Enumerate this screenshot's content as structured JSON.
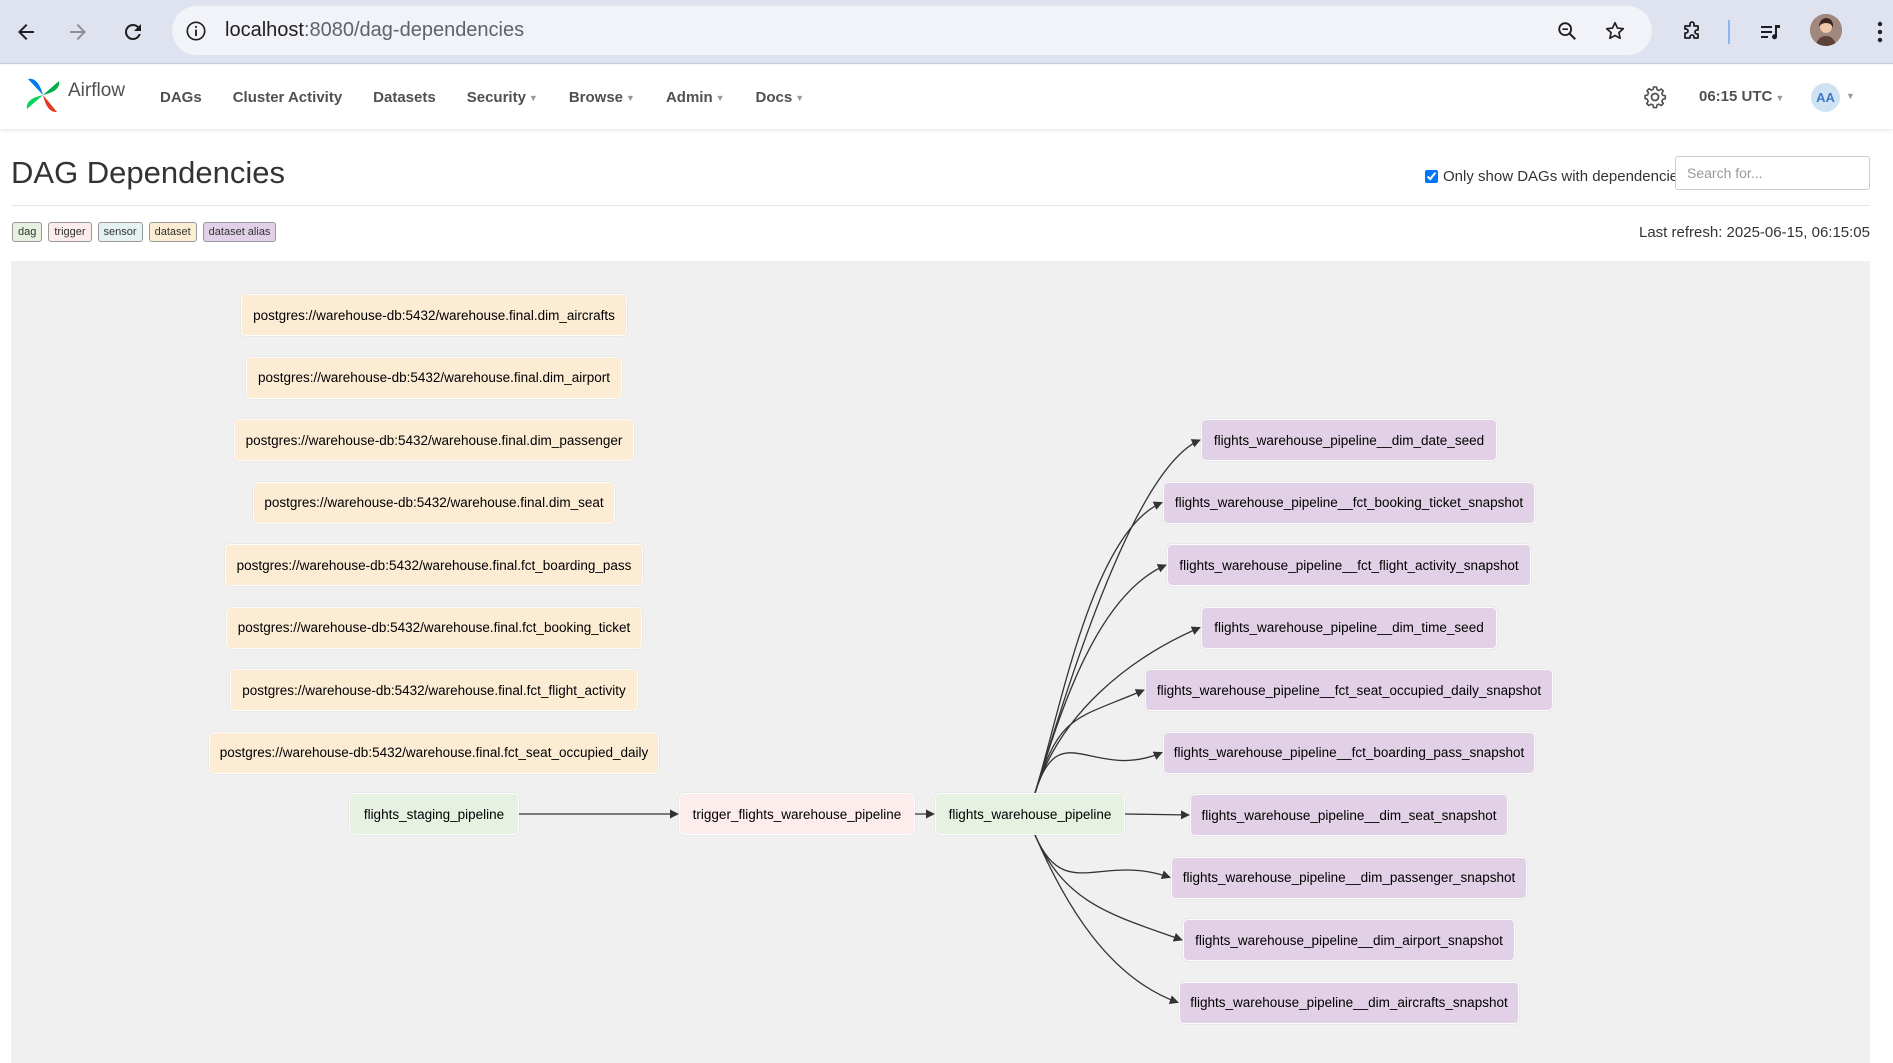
{
  "browser": {
    "url_host": "localhost",
    "url_path": ":8080/dag-dependencies"
  },
  "navbar": {
    "brand": "Airflow",
    "menu": [
      {
        "label": "DAGs",
        "dropdown": false
      },
      {
        "label": "Cluster Activity",
        "dropdown": false
      },
      {
        "label": "Datasets",
        "dropdown": false
      },
      {
        "label": "Security",
        "dropdown": true
      },
      {
        "label": "Browse",
        "dropdown": true
      },
      {
        "label": "Admin",
        "dropdown": true
      },
      {
        "label": "Docs",
        "dropdown": true
      }
    ],
    "time": "06:15 UTC",
    "avatar_initials": "AA"
  },
  "page": {
    "title": "DAG Dependencies",
    "filter_label": "Only show DAGs with dependencies",
    "filter_checked": true,
    "search_placeholder": "Search for...",
    "last_refresh": "Last refresh: 2025-06-15, 06:15:05"
  },
  "legend": [
    {
      "label": "dag",
      "color": "#e6f1e2"
    },
    {
      "label": "trigger",
      "color": "#fceceb"
    },
    {
      "label": "sensor",
      "color": "#e6f1f2"
    },
    {
      "label": "dataset",
      "color": "#fcecd4"
    },
    {
      "label": "dataset alias",
      "color": "#e2d1e6"
    }
  ],
  "datasets": [
    "postgres://warehouse-db:5432/warehouse.final.dim_aircrafts",
    "postgres://warehouse-db:5432/warehouse.final.dim_airport",
    "postgres://warehouse-db:5432/warehouse.final.dim_passenger",
    "postgres://warehouse-db:5432/warehouse.final.dim_seat",
    "postgres://warehouse-db:5432/warehouse.final.fct_boarding_pass",
    "postgres://warehouse-db:5432/warehouse.final.fct_booking_ticket",
    "postgres://warehouse-db:5432/warehouse.final.fct_flight_activity",
    "postgres://warehouse-db:5432/warehouse.final.fct_seat_occupied_daily"
  ],
  "flow": {
    "source_dag": "flights_staging_pipeline",
    "trigger": "trigger_flights_warehouse_pipeline",
    "target_dag": "flights_warehouse_pipeline"
  },
  "aliases": [
    "flights_warehouse_pipeline__dim_date_seed",
    "flights_warehouse_pipeline__fct_booking_ticket_snapshot",
    "flights_warehouse_pipeline__fct_flight_activity_snapshot",
    "flights_warehouse_pipeline__dim_time_seed",
    "flights_warehouse_pipeline__fct_seat_occupied_daily_snapshot",
    "flights_warehouse_pipeline__fct_boarding_pass_snapshot",
    "flights_warehouse_pipeline__dim_seat_snapshot",
    "flights_warehouse_pipeline__dim_passenger_snapshot",
    "flights_warehouse_pipeline__dim_airport_snapshot",
    "flights_warehouse_pipeline__dim_aircrafts_snapshot"
  ]
}
